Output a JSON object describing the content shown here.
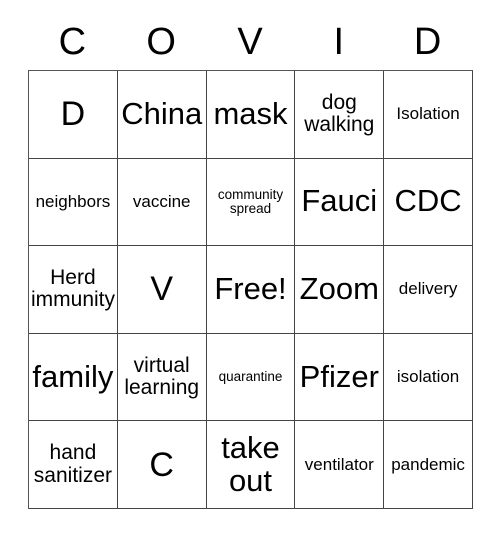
{
  "card": {
    "title_letters": [
      "C",
      "O",
      "V",
      "I",
      "D"
    ],
    "columns": 5,
    "rows": 5,
    "free_space": "Free!",
    "border_color": "#444444",
    "text_color": "#000000",
    "background_color": "#ffffff",
    "cells": [
      [
        {
          "text": "D",
          "size": "fs-xxl"
        },
        {
          "text": "China",
          "size": "fs-xl"
        },
        {
          "text": "mask",
          "size": "fs-xl"
        },
        {
          "text": "dog\nwalking",
          "size": "fs-l"
        },
        {
          "text": "Isolation",
          "size": "fs-m"
        }
      ],
      [
        {
          "text": "neighbors",
          "size": "fs-m"
        },
        {
          "text": "vaccine",
          "size": "fs-m"
        },
        {
          "text": "community\nspread",
          "size": "fs-s"
        },
        {
          "text": "Fauci",
          "size": "fs-xl"
        },
        {
          "text": "CDC",
          "size": "fs-xl"
        }
      ],
      [
        {
          "text": "Herd\nimmunity",
          "size": "fs-l"
        },
        {
          "text": "V",
          "size": "fs-xxl"
        },
        {
          "text": "Free!",
          "size": "fs-xl"
        },
        {
          "text": "Zoom",
          "size": "fs-xl"
        },
        {
          "text": "delivery",
          "size": "fs-m"
        }
      ],
      [
        {
          "text": "family",
          "size": "fs-xl"
        },
        {
          "text": "virtual\nlearning",
          "size": "fs-l"
        },
        {
          "text": "quarantine",
          "size": "fs-s"
        },
        {
          "text": "Pfizer",
          "size": "fs-xl"
        },
        {
          "text": "isolation",
          "size": "fs-m"
        }
      ],
      [
        {
          "text": "hand\nsanitizer",
          "size": "fs-l"
        },
        {
          "text": "C",
          "size": "fs-xxl"
        },
        {
          "text": "take\nout",
          "size": "fs-xl"
        },
        {
          "text": "ventilator",
          "size": "fs-m"
        },
        {
          "text": "pandemic",
          "size": "fs-m"
        }
      ]
    ]
  }
}
